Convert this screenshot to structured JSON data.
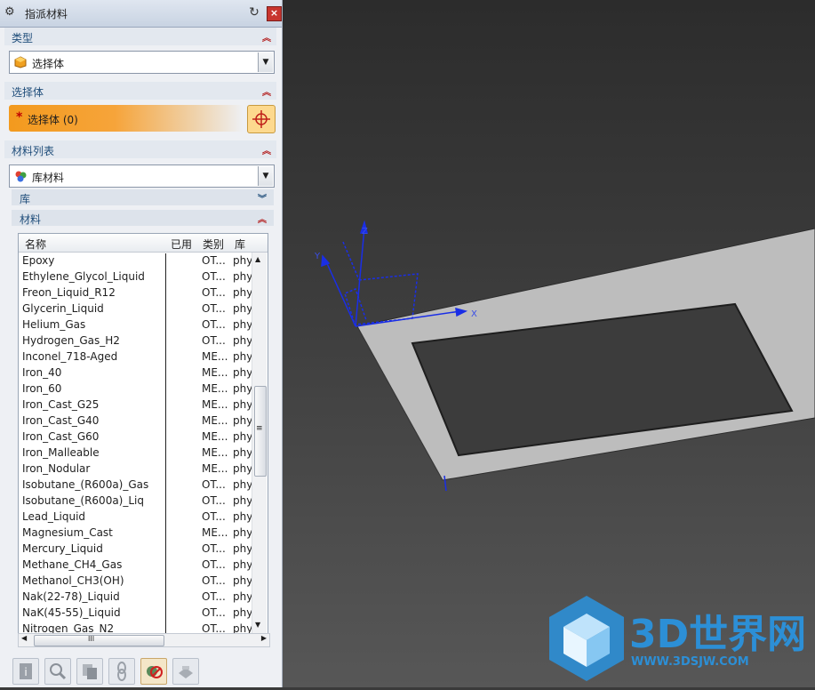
{
  "window": {
    "title": "指派材料"
  },
  "type_group": {
    "header": "类型",
    "combo_value": "选择体"
  },
  "select_group": {
    "header": "选择体",
    "select_label": "选择体 (0)",
    "required_mark": "*"
  },
  "material_list_group": {
    "header": "材料列表",
    "combo_value": "库材料"
  },
  "library_section": {
    "header": "库"
  },
  "materials_section": {
    "header": "材料"
  },
  "table": {
    "columns": [
      "名称",
      "已用",
      "类别",
      "库"
    ],
    "rows": [
      {
        "name": "Epoxy",
        "category": "OT...",
        "library": "phy"
      },
      {
        "name": "Ethylene_Glycol_Liquid",
        "category": "OT...",
        "library": "phy"
      },
      {
        "name": "Freon_Liquid_R12",
        "category": "OT...",
        "library": "phy"
      },
      {
        "name": "Glycerin_Liquid",
        "category": "OT...",
        "library": "phy"
      },
      {
        "name": "Helium_Gas",
        "category": "OT...",
        "library": "phy"
      },
      {
        "name": "Hydrogen_Gas_H2",
        "category": "OT...",
        "library": "phy"
      },
      {
        "name": "Inconel_718-Aged",
        "category": "ME...",
        "library": "phy"
      },
      {
        "name": "Iron_40",
        "category": "ME...",
        "library": "phy"
      },
      {
        "name": "Iron_60",
        "category": "ME...",
        "library": "phy"
      },
      {
        "name": "Iron_Cast_G25",
        "category": "ME...",
        "library": "phy"
      },
      {
        "name": "Iron_Cast_G40",
        "category": "ME...",
        "library": "phy"
      },
      {
        "name": "Iron_Cast_G60",
        "category": "ME...",
        "library": "phy"
      },
      {
        "name": "Iron_Malleable",
        "category": "ME...",
        "library": "phy"
      },
      {
        "name": "Iron_Nodular",
        "category": "ME...",
        "library": "phy"
      },
      {
        "name": "Isobutane_(R600a)_Gas",
        "category": "OT...",
        "library": "phy"
      },
      {
        "name": "Isobutane_(R600a)_Liq",
        "category": "OT...",
        "library": "phy"
      },
      {
        "name": "Lead_Liquid",
        "category": "OT...",
        "library": "phy"
      },
      {
        "name": "Magnesium_Cast",
        "category": "ME...",
        "library": "phy"
      },
      {
        "name": "Mercury_Liquid",
        "category": "OT...",
        "library": "phy"
      },
      {
        "name": "Methane_CH4_Gas",
        "category": "OT...",
        "library": "phy"
      },
      {
        "name": "Methanol_CH3(OH)",
        "category": "OT...",
        "library": "phy"
      },
      {
        "name": "Nak(22-78)_Liquid",
        "category": "OT...",
        "library": "phy"
      },
      {
        "name": "NaK(45-55)_Liquid",
        "category": "OT...",
        "library": "phy"
      },
      {
        "name": "Nitrogen_Gas_N2",
        "category": "OT...",
        "library": "phy"
      }
    ]
  },
  "scrollbar": {
    "h_grip": "III",
    "v_grip": "≡"
  },
  "viewport": {
    "axis_labels": {
      "x": "X",
      "y": "Y",
      "z": "Z"
    },
    "watermark": {
      "brand": "3D世界网",
      "url": "WWW.3DSJW.COM"
    }
  },
  "colors": {
    "accent_orange": "#f39a1e",
    "axis_blue": "#1a2ee6",
    "plate_gray": "#b8b8b8",
    "watermark_blue": "#2c8fd6"
  }
}
